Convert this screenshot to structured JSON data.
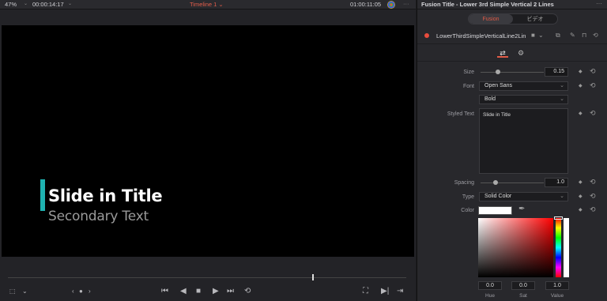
{
  "viewer": {
    "zoom": "47%",
    "timecode_left": "00:00:14:17",
    "timeline_name": "Timeline 1",
    "timecode_right": "01:00:11:05",
    "title_text": "Slide in Title",
    "subtitle_text": "Secondary Text",
    "bar_color": "#1fb2b0",
    "timeline_accent": "#e35d4a"
  },
  "transport": {
    "icons": [
      "crop-icon",
      "chevron-down-icon",
      "prev-clip-icon",
      "dot-icon",
      "next-clip-icon",
      "go-to-start-icon",
      "play-reverse-icon",
      "stop-icon",
      "play-icon",
      "go-to-end-icon",
      "loop-icon",
      "fullscreen-icon",
      "next-frame-icon",
      "skip-end-icon"
    ]
  },
  "inspector": {
    "title": "Fusion Title - Lower 3rd Simple Vertical 2 Lines",
    "tabs": [
      "Fusion",
      "ビデオ"
    ],
    "active_tab": "Fusion",
    "accent": "#e05a46",
    "node_name": "LowerThirdSimpleVerticalLine2Lin",
    "size": {
      "label": "Size",
      "value": "0.15"
    },
    "font": {
      "label": "Font",
      "family": "Open Sans",
      "style": "Bold"
    },
    "styled_text": {
      "label": "Styled Text",
      "value": "Slide in Title"
    },
    "spacing": {
      "label": "Spacing",
      "value": "1.0"
    },
    "type": {
      "label": "Type",
      "value": "Solid Color"
    },
    "color": {
      "label": "Color",
      "swatch": "#ffffff"
    },
    "hsv": {
      "hue": {
        "label": "Hue",
        "value": "0.0"
      },
      "sat": {
        "label": "Sat",
        "value": "0.0"
      },
      "value": {
        "label": "Value",
        "value": "1.0"
      }
    }
  }
}
